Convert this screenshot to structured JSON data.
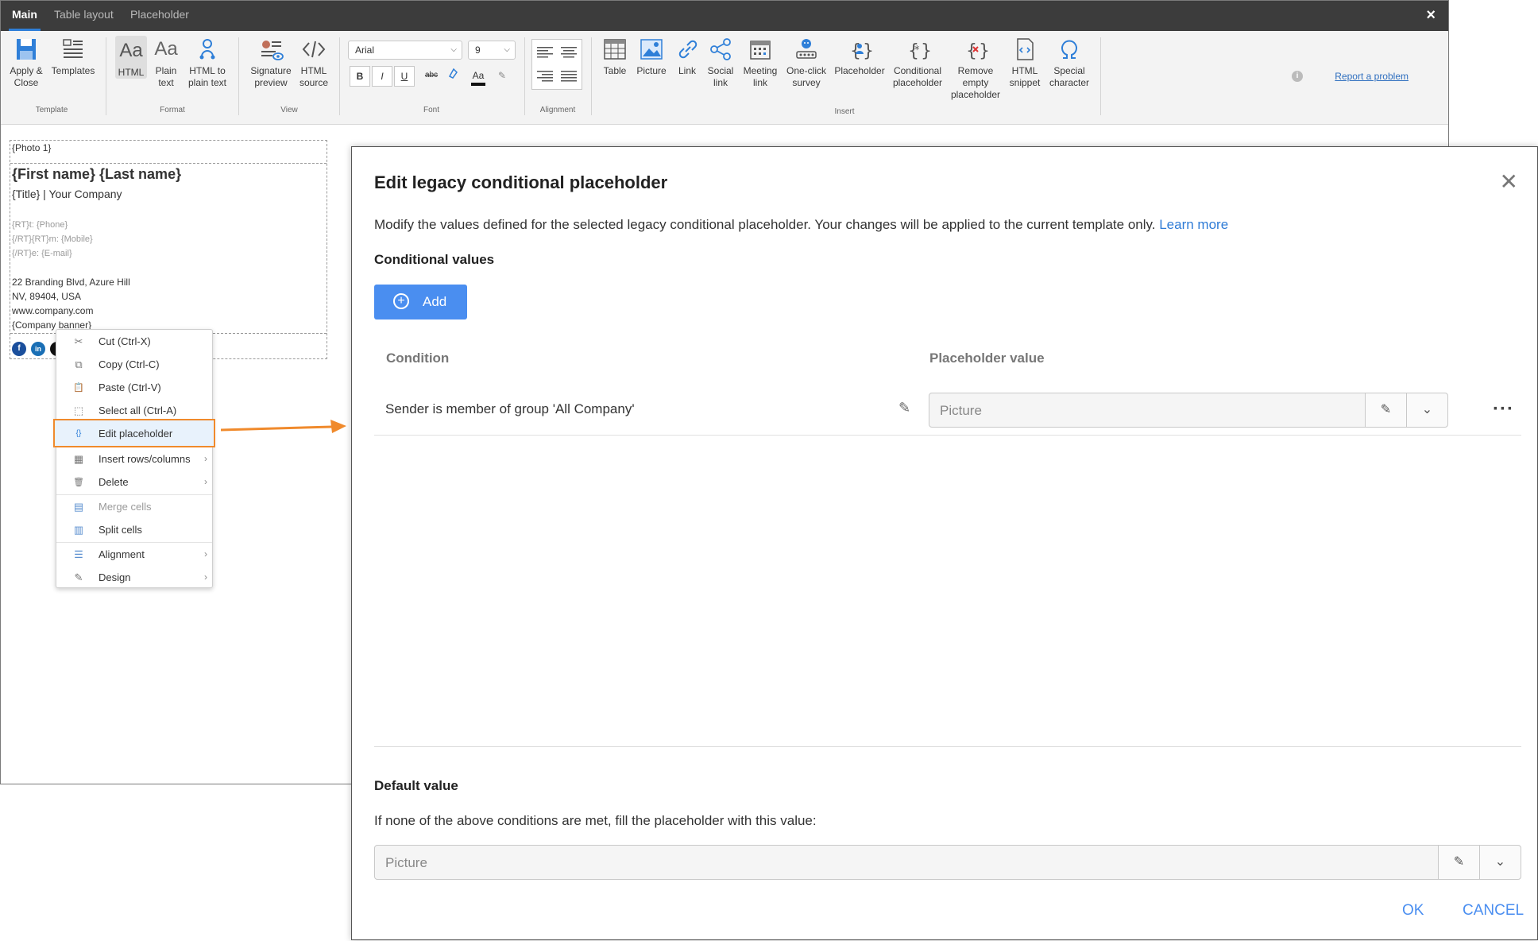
{
  "editor": {
    "tabs": [
      "Main",
      "Table layout",
      "Placeholder"
    ],
    "close_glyph": "×",
    "ribbon": {
      "template": {
        "apply_close": [
          "Apply &",
          "Close"
        ],
        "templates": "Templates",
        "group": "Template"
      },
      "format": {
        "html": "HTML",
        "plain": [
          "Plain",
          "text"
        ],
        "html_to_plain": [
          "HTML to",
          "plain text"
        ],
        "group": "Format"
      },
      "view": {
        "signature_preview": [
          "Signature",
          "preview"
        ],
        "html_source": [
          "HTML",
          "source"
        ],
        "group": "View"
      },
      "font": {
        "family": "Arial",
        "size": "9",
        "bold": "B",
        "italic": "I",
        "underline": "U",
        "strike": "abc",
        "group": "Font"
      },
      "alignment": {
        "group": "Alignment"
      },
      "insert": {
        "table": "Table",
        "picture": "Picture",
        "link": "Link",
        "social_link": [
          "Social",
          "link"
        ],
        "meeting_link": [
          "Meeting",
          "link"
        ],
        "one_click_survey": [
          "One-click",
          "survey"
        ],
        "placeholder": "Placeholder",
        "conditional_placeholder": [
          "Conditional",
          "placeholder"
        ],
        "remove_empty_placeholder": [
          "Remove",
          "empty",
          "placeholder"
        ],
        "html_snippet": [
          "HTML",
          "snippet"
        ],
        "special_character": [
          "Special",
          "character"
        ],
        "group": "Insert"
      },
      "report_problem": "Report a problem"
    },
    "signature": {
      "photo": "{Photo 1}",
      "name": "{First name} {Last name}",
      "title": "{Title} | Your Company",
      "phone": "{RT}t: {Phone}",
      "mobile": "{/RT}{RT}m: {Mobile}",
      "email": "{/RT}e: {E-mail}",
      "address1": "22 Branding Blvd, Azure Hill",
      "address2": "NV, 89404, USA",
      "website": "www.company.com",
      "banner": "{Company banner}",
      "social": {
        "facebook": "f",
        "linkedin": "in"
      }
    }
  },
  "context_menu": {
    "items": [
      {
        "label": "Cut (Ctrl-X)",
        "icon": "scissors-icon",
        "glyph": "✂"
      },
      {
        "label": "Copy (Ctrl-C)",
        "icon": "copy-icon",
        "glyph": "⧉"
      },
      {
        "label": "Paste (Ctrl-V)",
        "icon": "paste-icon",
        "glyph": "📋"
      },
      {
        "label": "Select all (Ctrl-A)",
        "icon": "select-all-icon",
        "glyph": "⬚"
      },
      {
        "label": "Edit placeholder",
        "icon": "placeholder-icon",
        "glyph": "{}"
      },
      {
        "label": "Insert rows/columns",
        "icon": "table-icon",
        "glyph": "▦"
      },
      {
        "label": "Delete",
        "icon": "trash-icon",
        "glyph": "🗑"
      },
      {
        "label": "Merge cells",
        "icon": "merge-icon",
        "glyph": "▤"
      },
      {
        "label": "Split cells",
        "icon": "split-icon",
        "glyph": "▥"
      },
      {
        "label": "Alignment",
        "icon": "align-icon",
        "glyph": "☰"
      },
      {
        "label": "Design",
        "icon": "pencil-icon",
        "glyph": "✎"
      }
    ]
  },
  "dialog": {
    "title": "Edit legacy conditional placeholder",
    "description": "Modify the values defined for the selected legacy conditional placeholder. Your changes will be applied to the current template only.",
    "learn_more": "Learn more",
    "conditional_heading": "Conditional values",
    "add_label": "Add",
    "col_condition": "Condition",
    "col_value": "Placeholder value",
    "rows": [
      {
        "condition": "Sender is member of group 'All Company'",
        "value_placeholder": "Picture"
      }
    ],
    "default_heading": "Default value",
    "default_description": "If none of the above conditions are met, fill the placeholder with this value:",
    "default_placeholder": "Picture",
    "ok": "OK",
    "cancel": "CANCEL"
  },
  "colors": {
    "accent": "#4a8ef0",
    "highlight_border": "#f08a2c",
    "topbar": "#3c3c3c"
  }
}
